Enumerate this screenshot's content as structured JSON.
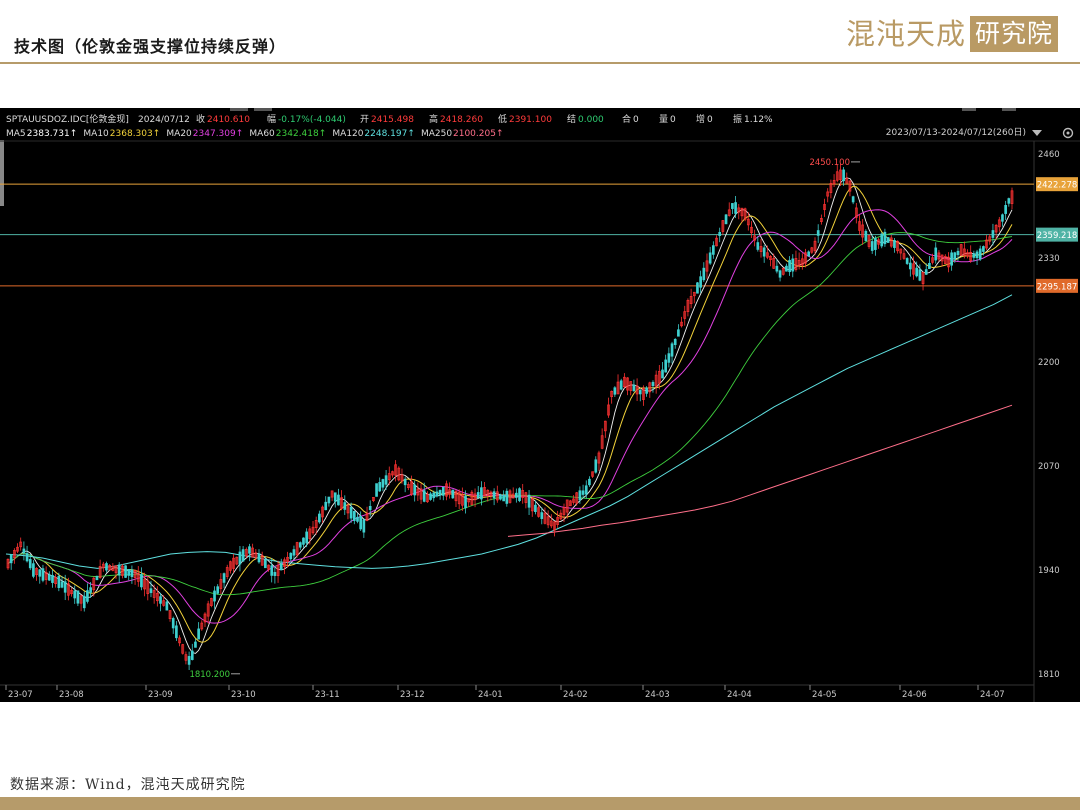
{
  "header": {
    "title": "技术图（伦敦金强支撑位持续反弹）",
    "logo_main": "混沌天成",
    "logo_box": "研究院"
  },
  "footer": {
    "source": "数据来源：Wind，混沌天成研究院"
  },
  "quote_bar": {
    "symbol": "SPTAUUSDOZ.IDC[伦敦金现]",
    "date": "2024/07/12",
    "fields": [
      {
        "label": "收",
        "value": "2410.610",
        "color": "#ff3b3b"
      },
      {
        "label": "幅",
        "value": "-0.17%(-4.044)",
        "color": "#2ecc71"
      },
      {
        "label": "开",
        "value": "2415.498",
        "color": "#ff3b3b"
      },
      {
        "label": "高",
        "value": "2418.260",
        "color": "#ff3b3b"
      },
      {
        "label": "低",
        "value": "2391.100",
        "color": "#ff3b3b"
      },
      {
        "label": "结",
        "value": "0.000",
        "color": "#2ecc71"
      },
      {
        "label": "合",
        "value": "0",
        "color": "#dddddd"
      },
      {
        "label": "量",
        "value": "0",
        "color": "#dddddd"
      },
      {
        "label": "增",
        "value": "0",
        "color": "#dddddd"
      },
      {
        "label": "振",
        "value": "1.12%",
        "color": "#dddddd"
      }
    ]
  },
  "ma_legend": [
    {
      "name": "MA5",
      "value": "2383.731↑",
      "color": "#ffffff"
    },
    {
      "name": "MA10",
      "value": "2368.303↑",
      "color": "#f2d23a"
    },
    {
      "name": "MA20",
      "value": "2347.309↑",
      "color": "#e040e0"
    },
    {
      "name": "MA60",
      "value": "2342.418↑",
      "color": "#3ecf3e"
    },
    {
      "name": "MA120",
      "value": "2248.197↑",
      "color": "#5fe0e0"
    },
    {
      "name": "MA250",
      "value": "2100.205↑",
      "color": "#ff6f8a"
    }
  ],
  "range_label": "2023/07/13-2024/07/12(260日)",
  "chart_data": {
    "type": "candlestick",
    "y_ticks": [
      2460,
      2330,
      2200,
      2070,
      1940,
      1810
    ],
    "x_ticks": [
      "23-07",
      "23-08",
      "23-09",
      "23-10",
      "23-11",
      "23-12",
      "24-01",
      "24-02",
      "24-03",
      "24-04",
      "24-05",
      "24-06",
      "24-07"
    ],
    "ylim": [
      1800,
      2470
    ],
    "price_lines": [
      {
        "label": "2422.278",
        "value": 2422.278,
        "color": "#e8a33a"
      },
      {
        "label": "2359.218",
        "value": 2359.218,
        "color": "#4fb3a5"
      },
      {
        "label": "2295.187",
        "value": 2295.187,
        "color": "#e06a2a"
      }
    ],
    "annotations": [
      {
        "text": "2450.100",
        "value": 2450.1
      },
      {
        "text": "1810.200",
        "value": 1810.2
      }
    ],
    "ma120": [
      1960,
      1958,
      1955,
      1950,
      1945,
      1942,
      1945,
      1950,
      1955,
      1960,
      1962,
      1963,
      1962,
      1958,
      1954,
      1950,
      1948,
      1946,
      1944,
      1943,
      1942,
      1943,
      1945,
      1948,
      1952,
      1956,
      1960,
      1966,
      1972,
      1980,
      1990,
      2000,
      2010,
      2020,
      2032,
      2046,
      2060,
      2074,
      2088,
      2102,
      2116,
      2130,
      2144,
      2156,
      2168,
      2180,
      2192,
      2202,
      2212,
      2222,
      2232,
      2242,
      2252,
      2262,
      2272,
      2284
    ],
    "ma250": [
      1982,
      1984,
      1986,
      1989,
      1992,
      1996,
      1999,
      2003,
      2007,
      2011,
      2015,
      2020,
      2026,
      2034,
      2042,
      2050,
      2058,
      2066,
      2074,
      2082,
      2090,
      2098,
      2106,
      2114,
      2122,
      2130,
      2138,
      2146
    ]
  }
}
